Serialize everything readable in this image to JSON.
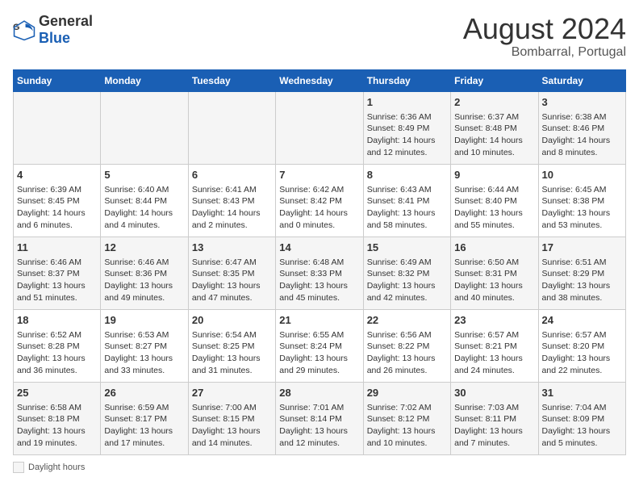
{
  "header": {
    "logo_general": "General",
    "logo_blue": "Blue",
    "main_title": "August 2024",
    "subtitle": "Bombarral, Portugal"
  },
  "days_of_week": [
    "Sunday",
    "Monday",
    "Tuesday",
    "Wednesday",
    "Thursday",
    "Friday",
    "Saturday"
  ],
  "weeks": [
    [
      {
        "day": "",
        "content": ""
      },
      {
        "day": "",
        "content": ""
      },
      {
        "day": "",
        "content": ""
      },
      {
        "day": "",
        "content": ""
      },
      {
        "day": "1",
        "content": "Sunrise: 6:36 AM\nSunset: 8:49 PM\nDaylight: 14 hours and 12 minutes."
      },
      {
        "day": "2",
        "content": "Sunrise: 6:37 AM\nSunset: 8:48 PM\nDaylight: 14 hours and 10 minutes."
      },
      {
        "day": "3",
        "content": "Sunrise: 6:38 AM\nSunset: 8:46 PM\nDaylight: 14 hours and 8 minutes."
      }
    ],
    [
      {
        "day": "4",
        "content": "Sunrise: 6:39 AM\nSunset: 8:45 PM\nDaylight: 14 hours and 6 minutes."
      },
      {
        "day": "5",
        "content": "Sunrise: 6:40 AM\nSunset: 8:44 PM\nDaylight: 14 hours and 4 minutes."
      },
      {
        "day": "6",
        "content": "Sunrise: 6:41 AM\nSunset: 8:43 PM\nDaylight: 14 hours and 2 minutes."
      },
      {
        "day": "7",
        "content": "Sunrise: 6:42 AM\nSunset: 8:42 PM\nDaylight: 14 hours and 0 minutes."
      },
      {
        "day": "8",
        "content": "Sunrise: 6:43 AM\nSunset: 8:41 PM\nDaylight: 13 hours and 58 minutes."
      },
      {
        "day": "9",
        "content": "Sunrise: 6:44 AM\nSunset: 8:40 PM\nDaylight: 13 hours and 55 minutes."
      },
      {
        "day": "10",
        "content": "Sunrise: 6:45 AM\nSunset: 8:38 PM\nDaylight: 13 hours and 53 minutes."
      }
    ],
    [
      {
        "day": "11",
        "content": "Sunrise: 6:46 AM\nSunset: 8:37 PM\nDaylight: 13 hours and 51 minutes."
      },
      {
        "day": "12",
        "content": "Sunrise: 6:46 AM\nSunset: 8:36 PM\nDaylight: 13 hours and 49 minutes."
      },
      {
        "day": "13",
        "content": "Sunrise: 6:47 AM\nSunset: 8:35 PM\nDaylight: 13 hours and 47 minutes."
      },
      {
        "day": "14",
        "content": "Sunrise: 6:48 AM\nSunset: 8:33 PM\nDaylight: 13 hours and 45 minutes."
      },
      {
        "day": "15",
        "content": "Sunrise: 6:49 AM\nSunset: 8:32 PM\nDaylight: 13 hours and 42 minutes."
      },
      {
        "day": "16",
        "content": "Sunrise: 6:50 AM\nSunset: 8:31 PM\nDaylight: 13 hours and 40 minutes."
      },
      {
        "day": "17",
        "content": "Sunrise: 6:51 AM\nSunset: 8:29 PM\nDaylight: 13 hours and 38 minutes."
      }
    ],
    [
      {
        "day": "18",
        "content": "Sunrise: 6:52 AM\nSunset: 8:28 PM\nDaylight: 13 hours and 36 minutes."
      },
      {
        "day": "19",
        "content": "Sunrise: 6:53 AM\nSunset: 8:27 PM\nDaylight: 13 hours and 33 minutes."
      },
      {
        "day": "20",
        "content": "Sunrise: 6:54 AM\nSunset: 8:25 PM\nDaylight: 13 hours and 31 minutes."
      },
      {
        "day": "21",
        "content": "Sunrise: 6:55 AM\nSunset: 8:24 PM\nDaylight: 13 hours and 29 minutes."
      },
      {
        "day": "22",
        "content": "Sunrise: 6:56 AM\nSunset: 8:22 PM\nDaylight: 13 hours and 26 minutes."
      },
      {
        "day": "23",
        "content": "Sunrise: 6:57 AM\nSunset: 8:21 PM\nDaylight: 13 hours and 24 minutes."
      },
      {
        "day": "24",
        "content": "Sunrise: 6:57 AM\nSunset: 8:20 PM\nDaylight: 13 hours and 22 minutes."
      }
    ],
    [
      {
        "day": "25",
        "content": "Sunrise: 6:58 AM\nSunset: 8:18 PM\nDaylight: 13 hours and 19 minutes."
      },
      {
        "day": "26",
        "content": "Sunrise: 6:59 AM\nSunset: 8:17 PM\nDaylight: 13 hours and 17 minutes."
      },
      {
        "day": "27",
        "content": "Sunrise: 7:00 AM\nSunset: 8:15 PM\nDaylight: 13 hours and 14 minutes."
      },
      {
        "day": "28",
        "content": "Sunrise: 7:01 AM\nSunset: 8:14 PM\nDaylight: 13 hours and 12 minutes."
      },
      {
        "day": "29",
        "content": "Sunrise: 7:02 AM\nSunset: 8:12 PM\nDaylight: 13 hours and 10 minutes."
      },
      {
        "day": "30",
        "content": "Sunrise: 7:03 AM\nSunset: 8:11 PM\nDaylight: 13 hours and 7 minutes."
      },
      {
        "day": "31",
        "content": "Sunrise: 7:04 AM\nSunset: 8:09 PM\nDaylight: 13 hours and 5 minutes."
      }
    ]
  ],
  "legend": {
    "daylight_label": "Daylight hours"
  }
}
